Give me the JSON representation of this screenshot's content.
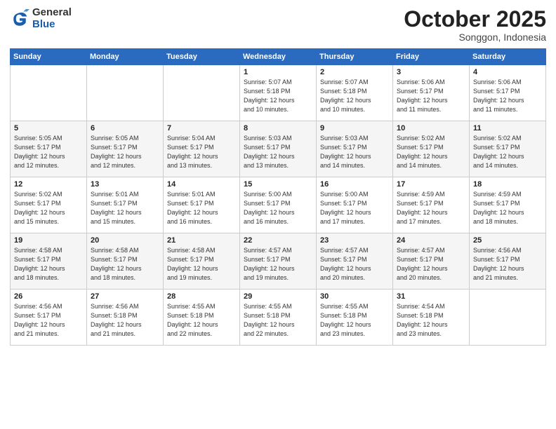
{
  "logo": {
    "general": "General",
    "blue": "Blue"
  },
  "title": "October 2025",
  "location": "Songgon, Indonesia",
  "days_header": [
    "Sunday",
    "Monday",
    "Tuesday",
    "Wednesday",
    "Thursday",
    "Friday",
    "Saturday"
  ],
  "weeks": [
    [
      {
        "day": "",
        "info": ""
      },
      {
        "day": "",
        "info": ""
      },
      {
        "day": "",
        "info": ""
      },
      {
        "day": "1",
        "info": "Sunrise: 5:07 AM\nSunset: 5:18 PM\nDaylight: 12 hours\nand 10 minutes."
      },
      {
        "day": "2",
        "info": "Sunrise: 5:07 AM\nSunset: 5:18 PM\nDaylight: 12 hours\nand 10 minutes."
      },
      {
        "day": "3",
        "info": "Sunrise: 5:06 AM\nSunset: 5:17 PM\nDaylight: 12 hours\nand 11 minutes."
      },
      {
        "day": "4",
        "info": "Sunrise: 5:06 AM\nSunset: 5:17 PM\nDaylight: 12 hours\nand 11 minutes."
      }
    ],
    [
      {
        "day": "5",
        "info": "Sunrise: 5:05 AM\nSunset: 5:17 PM\nDaylight: 12 hours\nand 12 minutes."
      },
      {
        "day": "6",
        "info": "Sunrise: 5:05 AM\nSunset: 5:17 PM\nDaylight: 12 hours\nand 12 minutes."
      },
      {
        "day": "7",
        "info": "Sunrise: 5:04 AM\nSunset: 5:17 PM\nDaylight: 12 hours\nand 13 minutes."
      },
      {
        "day": "8",
        "info": "Sunrise: 5:03 AM\nSunset: 5:17 PM\nDaylight: 12 hours\nand 13 minutes."
      },
      {
        "day": "9",
        "info": "Sunrise: 5:03 AM\nSunset: 5:17 PM\nDaylight: 12 hours\nand 14 minutes."
      },
      {
        "day": "10",
        "info": "Sunrise: 5:02 AM\nSunset: 5:17 PM\nDaylight: 12 hours\nand 14 minutes."
      },
      {
        "day": "11",
        "info": "Sunrise: 5:02 AM\nSunset: 5:17 PM\nDaylight: 12 hours\nand 14 minutes."
      }
    ],
    [
      {
        "day": "12",
        "info": "Sunrise: 5:02 AM\nSunset: 5:17 PM\nDaylight: 12 hours\nand 15 minutes."
      },
      {
        "day": "13",
        "info": "Sunrise: 5:01 AM\nSunset: 5:17 PM\nDaylight: 12 hours\nand 15 minutes."
      },
      {
        "day": "14",
        "info": "Sunrise: 5:01 AM\nSunset: 5:17 PM\nDaylight: 12 hours\nand 16 minutes."
      },
      {
        "day": "15",
        "info": "Sunrise: 5:00 AM\nSunset: 5:17 PM\nDaylight: 12 hours\nand 16 minutes."
      },
      {
        "day": "16",
        "info": "Sunrise: 5:00 AM\nSunset: 5:17 PM\nDaylight: 12 hours\nand 17 minutes."
      },
      {
        "day": "17",
        "info": "Sunrise: 4:59 AM\nSunset: 5:17 PM\nDaylight: 12 hours\nand 17 minutes."
      },
      {
        "day": "18",
        "info": "Sunrise: 4:59 AM\nSunset: 5:17 PM\nDaylight: 12 hours\nand 18 minutes."
      }
    ],
    [
      {
        "day": "19",
        "info": "Sunrise: 4:58 AM\nSunset: 5:17 PM\nDaylight: 12 hours\nand 18 minutes."
      },
      {
        "day": "20",
        "info": "Sunrise: 4:58 AM\nSunset: 5:17 PM\nDaylight: 12 hours\nand 18 minutes."
      },
      {
        "day": "21",
        "info": "Sunrise: 4:58 AM\nSunset: 5:17 PM\nDaylight: 12 hours\nand 19 minutes."
      },
      {
        "day": "22",
        "info": "Sunrise: 4:57 AM\nSunset: 5:17 PM\nDaylight: 12 hours\nand 19 minutes."
      },
      {
        "day": "23",
        "info": "Sunrise: 4:57 AM\nSunset: 5:17 PM\nDaylight: 12 hours\nand 20 minutes."
      },
      {
        "day": "24",
        "info": "Sunrise: 4:57 AM\nSunset: 5:17 PM\nDaylight: 12 hours\nand 20 minutes."
      },
      {
        "day": "25",
        "info": "Sunrise: 4:56 AM\nSunset: 5:17 PM\nDaylight: 12 hours\nand 21 minutes."
      }
    ],
    [
      {
        "day": "26",
        "info": "Sunrise: 4:56 AM\nSunset: 5:17 PM\nDaylight: 12 hours\nand 21 minutes."
      },
      {
        "day": "27",
        "info": "Sunrise: 4:56 AM\nSunset: 5:18 PM\nDaylight: 12 hours\nand 21 minutes."
      },
      {
        "day": "28",
        "info": "Sunrise: 4:55 AM\nSunset: 5:18 PM\nDaylight: 12 hours\nand 22 minutes."
      },
      {
        "day": "29",
        "info": "Sunrise: 4:55 AM\nSunset: 5:18 PM\nDaylight: 12 hours\nand 22 minutes."
      },
      {
        "day": "30",
        "info": "Sunrise: 4:55 AM\nSunset: 5:18 PM\nDaylight: 12 hours\nand 23 minutes."
      },
      {
        "day": "31",
        "info": "Sunrise: 4:54 AM\nSunset: 5:18 PM\nDaylight: 12 hours\nand 23 minutes."
      },
      {
        "day": "",
        "info": ""
      }
    ]
  ]
}
